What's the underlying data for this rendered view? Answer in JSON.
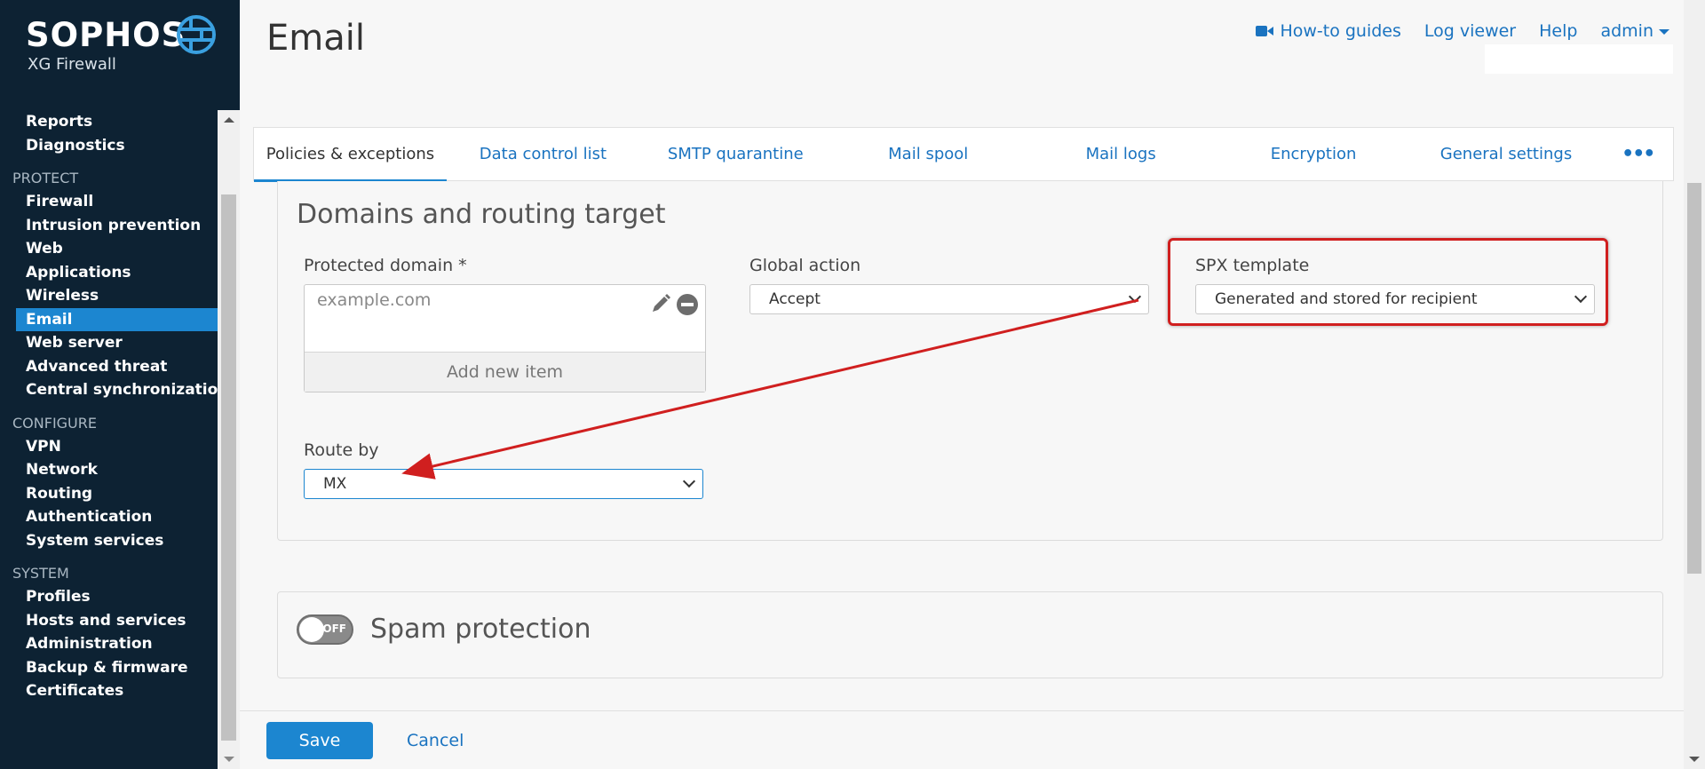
{
  "brand": {
    "name": "SOPHOS",
    "product": "XG Firewall"
  },
  "sidebar": {
    "groups": [
      {
        "heading": "",
        "items": [
          "Reports",
          "Diagnostics"
        ]
      },
      {
        "heading": "PROTECT",
        "items": [
          "Firewall",
          "Intrusion prevention",
          "Web",
          "Applications",
          "Wireless",
          "Email",
          "Web server",
          "Advanced threat",
          "Central synchronization"
        ]
      },
      {
        "heading": "CONFIGURE",
        "items": [
          "VPN",
          "Network",
          "Routing",
          "Authentication",
          "System services"
        ]
      },
      {
        "heading": "SYSTEM",
        "items": [
          "Profiles",
          "Hosts and services",
          "Administration",
          "Backup & firmware",
          "Certificates"
        ]
      }
    ],
    "active": "Email"
  },
  "header": {
    "title": "Email",
    "links": {
      "howto": "How-to guides",
      "logviewer": "Log viewer",
      "help": "Help",
      "admin": "admin"
    }
  },
  "tabs": [
    "Policies & exceptions",
    "Data control list",
    "SMTP quarantine",
    "Mail spool",
    "Mail logs",
    "Encryption",
    "General settings"
  ],
  "active_tab": "Policies & exceptions",
  "domains_panel": {
    "title": "Domains and routing target",
    "protected_domain_label": "Protected domain *",
    "protected_domain_placeholder": "example.com",
    "add_new_item": "Add new item",
    "global_action_label": "Global action",
    "global_action_value": "Accept",
    "spx_template_label": "SPX template",
    "spx_template_value": "Generated and stored for recipient",
    "route_by_label": "Route by",
    "route_by_value": "MX"
  },
  "spam_panel": {
    "title": "Spam protection",
    "toggle_label": "OFF",
    "enabled": false
  },
  "actions": {
    "save": "Save",
    "cancel": "Cancel"
  },
  "annotation_color": "#d01f1f",
  "accent_color": "#1c86d0"
}
